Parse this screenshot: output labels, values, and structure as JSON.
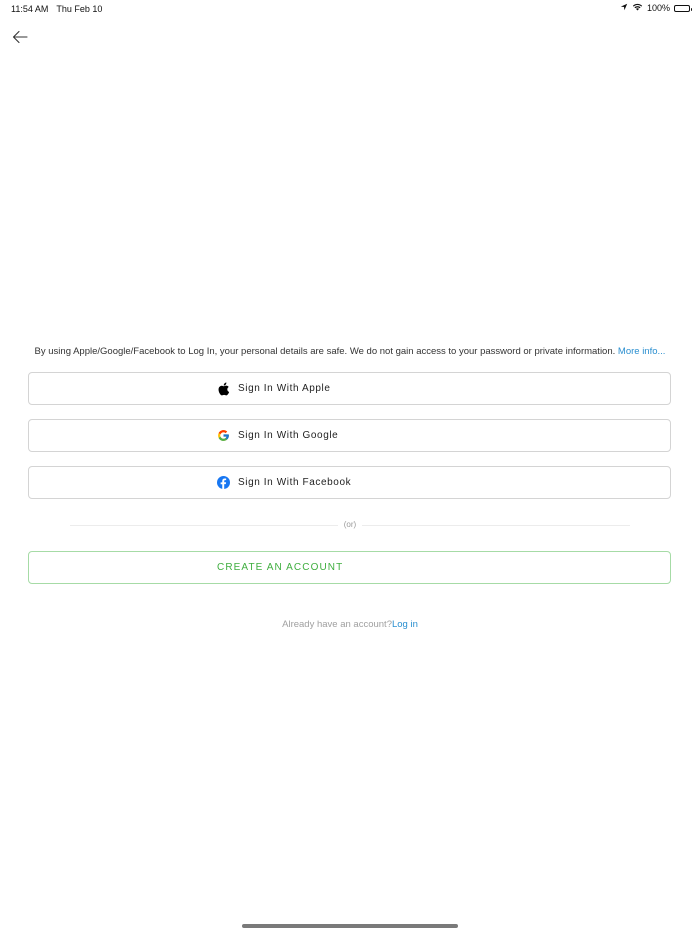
{
  "status_bar": {
    "time": "11:54 AM",
    "date": "Thu Feb 10",
    "battery": "100%"
  },
  "nav": {
    "back_icon": "arrow-left-icon"
  },
  "disclaimer": {
    "text": "By using Apple/Google/Facebook to Log In, your personal details are safe. We do not gain access to your password or private information.",
    "more_link": "More info..."
  },
  "social_buttons": [
    {
      "label": "Sign In With Apple",
      "icon": "apple-icon"
    },
    {
      "label": "Sign In With Google",
      "icon": "google-icon"
    },
    {
      "label": "Sign In With Facebook",
      "icon": "facebook-icon"
    }
  ],
  "divider": {
    "text": "(or)"
  },
  "create_account": {
    "label": "CREATE AN ACCOUNT"
  },
  "login": {
    "prompt": "Already have an account?",
    "link": "Log in"
  },
  "colors": {
    "accent_blue": "#2a8fd0",
    "create_green": "#3fae3f",
    "facebook_blue": "#1877f2"
  }
}
